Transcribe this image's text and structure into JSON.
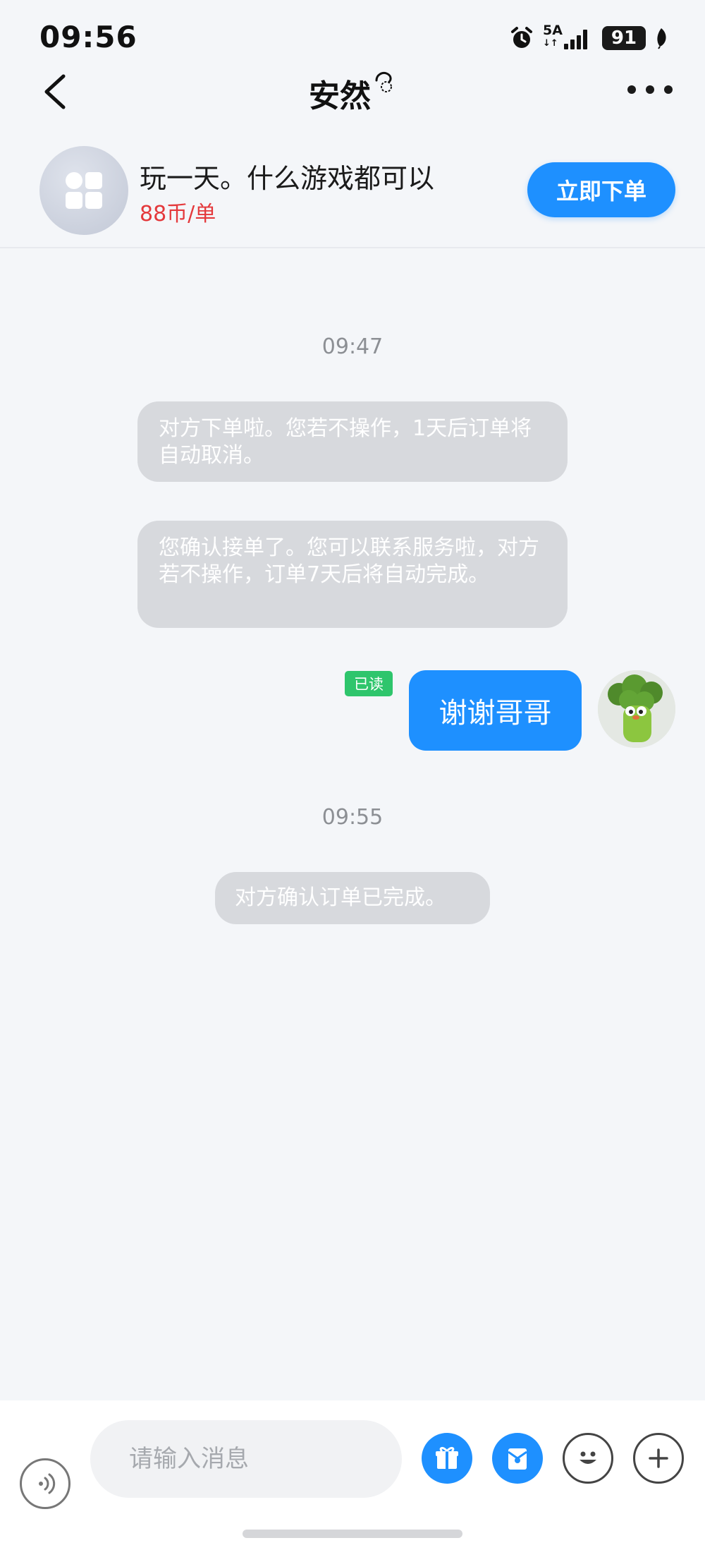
{
  "status_bar": {
    "time": "09:56",
    "network_label": "5A",
    "battery": "91",
    "alarm_icon": "alarm-clock-icon",
    "signal_icon": "signal-bars-icon",
    "leaf_icon": "leaf-icon"
  },
  "header": {
    "title": "安然",
    "back_icon": "chevron-left-icon",
    "more_icon": "more-dots-icon"
  },
  "service_card": {
    "title": "玩一天。什么游戏都可以",
    "price": "88币/单",
    "order_button": "立即下单",
    "icon": "app-grid-icon"
  },
  "chat": {
    "timestamp_1": "09:47",
    "system_message_1": "对方下单啦。您若不操作，1天后订单将自动取消。",
    "system_message_2": "您确认接单了。您可以联系服务啦，对方若不操作，订单7天后将自动完成。",
    "read_status": "已读",
    "my_message": "谢谢哥哥",
    "timestamp_2": "09:55",
    "system_message_3": "对方确认订单已完成。"
  },
  "input_bar": {
    "placeholder": "请输入消息",
    "voice_icon": "voice-icon",
    "gift_icon": "gift-icon",
    "wallet_icon": "red-packet-icon",
    "emoji_icon": "emoji-icon",
    "plus_icon": "plus-icon"
  },
  "colors": {
    "accent": "#1e90ff",
    "price": "#e4393c",
    "read_badge": "#2ec56c",
    "system_bubble": "#d7d9dd",
    "background": "#f4f6f9"
  }
}
